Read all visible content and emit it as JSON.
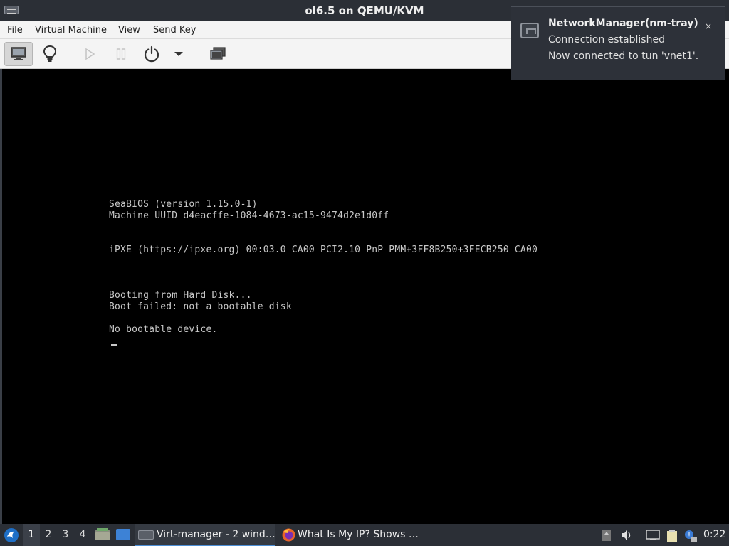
{
  "window": {
    "title": "ol6.5 on QEMU/KVM"
  },
  "menubar": {
    "items": [
      "File",
      "Virtual Machine",
      "View",
      "Send Key"
    ]
  },
  "toolbar": {
    "buttons": [
      {
        "name": "show-console",
        "icon": "monitor-icon",
        "active": true
      },
      {
        "name": "show-details",
        "icon": "lightbulb-icon",
        "active": false
      },
      {
        "name": "run",
        "icon": "play-icon",
        "active": false,
        "disabled": true
      },
      {
        "name": "pause",
        "icon": "pause-icon",
        "active": false,
        "disabled": true
      },
      {
        "name": "shutdown",
        "icon": "power-icon",
        "active": false
      },
      {
        "name": "shutdown-menu",
        "icon": "chevron-down-icon",
        "active": false
      },
      {
        "name": "fullscreen",
        "icon": "fullscreen-icon",
        "active": false
      }
    ]
  },
  "console": {
    "lines": [
      "SeaBIOS (version 1.15.0-1)",
      "Machine UUID d4eacffe-1084-4673-ac15-9474d2e1d0ff",
      "iPXE (https://ipxe.org) 00:03.0 CA00 PCI2.10 PnP PMM+3FF8B250+3FECB250 CA00",
      "Booting from Hard Disk...",
      "Boot failed: not a bootable disk",
      "No bootable device."
    ]
  },
  "notification": {
    "title": "NetworkManager(nm-tray)",
    "line1": "Connection established",
    "line2": "Now connected to tun 'vnet1'.",
    "close": "×"
  },
  "taskbar": {
    "workspaces": [
      "1",
      "2",
      "3",
      "4"
    ],
    "active_workspace": "1",
    "tasks": [
      {
        "label": "Virt-manager - 2 wind…",
        "icon": "virt-manager-icon",
        "active": true
      },
      {
        "label": "What Is My IP? Shows …",
        "icon": "firefox-icon",
        "active": false
      }
    ],
    "clock": "0:22"
  },
  "colors": {
    "titlebar": "#2b2f36",
    "toolbar": "#f4f4f4",
    "console_bg": "#000000",
    "console_text": "#c8c8c8",
    "taskbar_accent": "#4d8fd6"
  }
}
